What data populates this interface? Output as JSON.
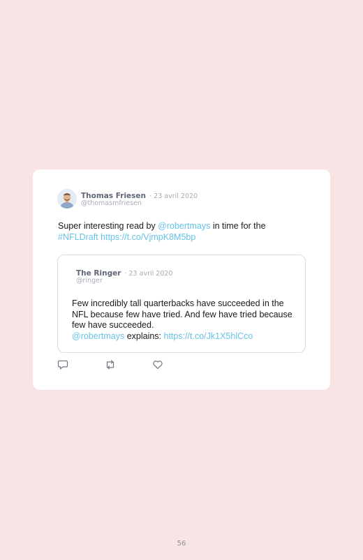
{
  "tweet": {
    "author_name": "Thomas Friesen",
    "date": "· 23 avril 2020",
    "handle": "@thomasmfriesen",
    "text_part1": "Super interesting read by ",
    "mention": "@robertmays",
    "text_part2": " in time for the ",
    "hashtag": "#NFLDraft",
    "link": "https://t.co/VjmpK8M5bp"
  },
  "quote": {
    "author_name": "The Ringer",
    "date": "· 23 avril 2020",
    "handle": "@ringer",
    "text": "Few incredibly tall quarterbacks have succeeded in the NFL because few have tried. And few have tried because few have succeeded.",
    "mention": "@robertmays",
    "text_part2": " explains: ",
    "link": "https://t.co/Jk1X5hlCco"
  },
  "actions": [
    "reply-icon",
    "retweet-icon",
    "like-icon"
  ],
  "colors": {
    "background": "#f8e4e4",
    "card": "#ffffff",
    "link": "#66c2e8",
    "name": "#5f6775",
    "meta": "#a6acb5"
  },
  "page_number": "56"
}
